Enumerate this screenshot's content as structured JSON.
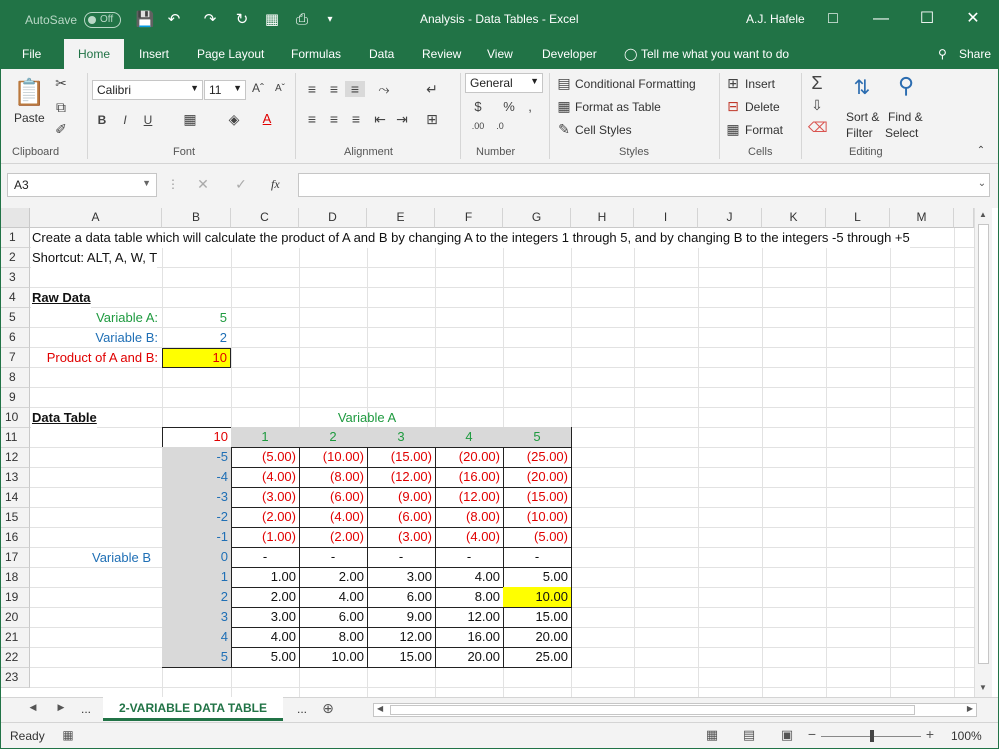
{
  "titlebar": {
    "autosave_label": "AutoSave",
    "autosave_state": "Off",
    "title": "Analysis - Data Tables  -  Excel",
    "user": "A.J. Hafele"
  },
  "ribbon_tabs": [
    "File",
    "Home",
    "Insert",
    "Page Layout",
    "Formulas",
    "Data",
    "Review",
    "View",
    "Developer"
  ],
  "tell_me": "Tell me what you want to do",
  "share": "Share",
  "ribbon": {
    "paste": "Paste",
    "font_name": "Calibri",
    "font_size": "11",
    "number_format": "General",
    "conditional_formatting": "Conditional Formatting",
    "format_as_table": "Format as Table",
    "cell_styles": "Cell Styles",
    "insert": "Insert",
    "delete": "Delete",
    "format": "Format",
    "sort_filter_1": "Sort &",
    "sort_filter_2": "Filter",
    "find_select_1": "Find &",
    "find_select_2": "Select",
    "groups": {
      "clipboard": "Clipboard",
      "font": "Font",
      "alignment": "Alignment",
      "number": "Number",
      "styles": "Styles",
      "cells": "Cells",
      "editing": "Editing"
    }
  },
  "formula_bar": {
    "name_box": "A3",
    "fx": "fx",
    "formula": ""
  },
  "columns": [
    "A",
    "B",
    "C",
    "D",
    "E",
    "F",
    "G",
    "H",
    "I",
    "J",
    "K",
    "L",
    "M"
  ],
  "rows": [
    "1",
    "2",
    "3",
    "4",
    "5",
    "6",
    "7",
    "8",
    "9",
    "10",
    "11",
    "12",
    "13",
    "14",
    "15",
    "16",
    "17",
    "18",
    "19",
    "20",
    "21",
    "22",
    "23"
  ],
  "sheet": {
    "r1": "Create a data table which will calculate the product of A and B by changing A to the integers 1 through 5, and by changing B to the integers -5 through +5",
    "r2": "Shortcut: ALT, A, W, T",
    "raw_data": "Raw Data",
    "var_a_label": "Variable A:",
    "var_a_value": "5",
    "var_b_label": "Variable B:",
    "var_b_value": "2",
    "product_label": "Product of A and B:",
    "product_value": "10",
    "data_table_label": "Data Table",
    "variable_a_header": "Variable A",
    "variable_b_label": "Variable B",
    "corner_value": "10",
    "a_values": [
      "1",
      "2",
      "3",
      "4",
      "5"
    ],
    "b_values": [
      "-5",
      "-4",
      "-3",
      "-2",
      "-1",
      "0",
      "1",
      "2",
      "3",
      "4",
      "5"
    ],
    "table": [
      [
        "(5.00)",
        "(10.00)",
        "(15.00)",
        "(20.00)",
        "(25.00)"
      ],
      [
        "(4.00)",
        "(8.00)",
        "(12.00)",
        "(16.00)",
        "(20.00)"
      ],
      [
        "(3.00)",
        "(6.00)",
        "(9.00)",
        "(12.00)",
        "(15.00)"
      ],
      [
        "(2.00)",
        "(4.00)",
        "(6.00)",
        "(8.00)",
        "(10.00)"
      ],
      [
        "(1.00)",
        "(2.00)",
        "(3.00)",
        "(4.00)",
        "(5.00)"
      ],
      [
        "-",
        "-",
        "-",
        "-",
        "-"
      ],
      [
        "1.00",
        "2.00",
        "3.00",
        "4.00",
        "5.00"
      ],
      [
        "2.00",
        "4.00",
        "6.00",
        "8.00",
        "10.00"
      ],
      [
        "3.00",
        "6.00",
        "9.00",
        "12.00",
        "15.00"
      ],
      [
        "4.00",
        "8.00",
        "12.00",
        "16.00",
        "20.00"
      ],
      [
        "5.00",
        "10.00",
        "15.00",
        "20.00",
        "25.00"
      ]
    ],
    "highlight_color": "#ffff00",
    "colors": {
      "green": "#1e9a3f",
      "blue": "#1f6fb5",
      "red": "#e00000"
    }
  },
  "sheet_tabs": {
    "active": "2-VARIABLE DATA TABLE",
    "more_left": "...",
    "more_right": "..."
  },
  "status": {
    "ready": "Ready",
    "zoom": "100%"
  }
}
